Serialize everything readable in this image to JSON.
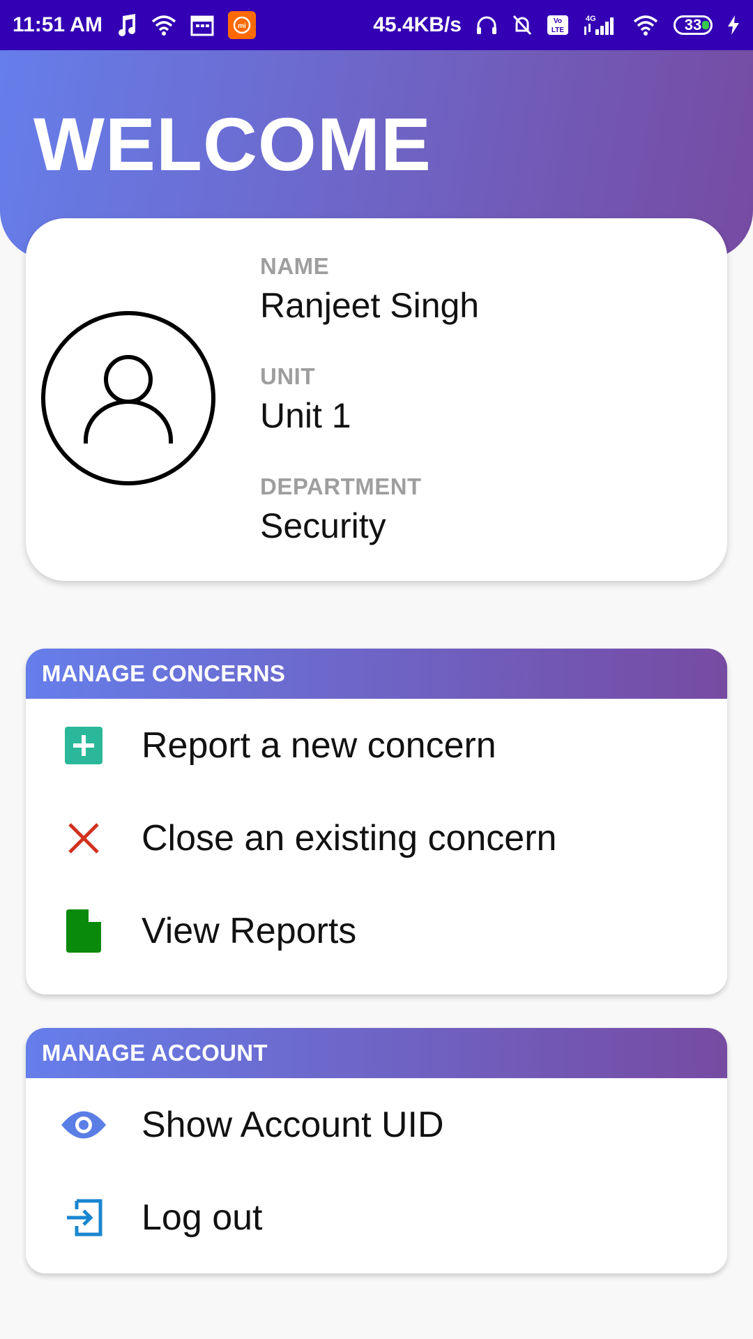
{
  "status_bar": {
    "time": "11:51 AM",
    "speed": "45.4KB/s",
    "network": "4G",
    "volte": "Vo LTE",
    "battery": "33",
    "icons": [
      "music-note-icon",
      "wifi-icon",
      "calendar-icon",
      "mi-app-icon",
      "headphones-icon",
      "bell-off-icon",
      "volte-icon",
      "signal-icon",
      "wifi-icon",
      "battery-icon",
      "charging-icon"
    ]
  },
  "header": {
    "title": "WELCOME"
  },
  "profile": {
    "name_label": "NAME",
    "name": "Ranjeet Singh",
    "unit_label": "UNIT",
    "unit": "Unit 1",
    "department_label": "DEPARTMENT",
    "department": "Security",
    "avatar_icon": "user-avatar-icon"
  },
  "manage_concerns": {
    "title": "MANAGE CONCERNS",
    "items": [
      {
        "label": "Report a new concern",
        "icon": "add-square-icon",
        "color": "#2bb89a"
      },
      {
        "label": "Close an existing concern",
        "icon": "close-x-icon",
        "color": "#d0321e"
      },
      {
        "label": "View Reports",
        "icon": "document-icon",
        "color": "#0a8a0a"
      }
    ]
  },
  "manage_account": {
    "title": "MANAGE ACCOUNT",
    "items": [
      {
        "label": "Show Account UID",
        "icon": "eye-icon",
        "color": "#5b7ee5"
      },
      {
        "label": "Log out",
        "icon": "logout-icon",
        "color": "#1a86d0"
      }
    ]
  },
  "colors": {
    "status_bar": "#3300b3",
    "gradient_start": "#667eea",
    "gradient_end": "#764ba2"
  }
}
